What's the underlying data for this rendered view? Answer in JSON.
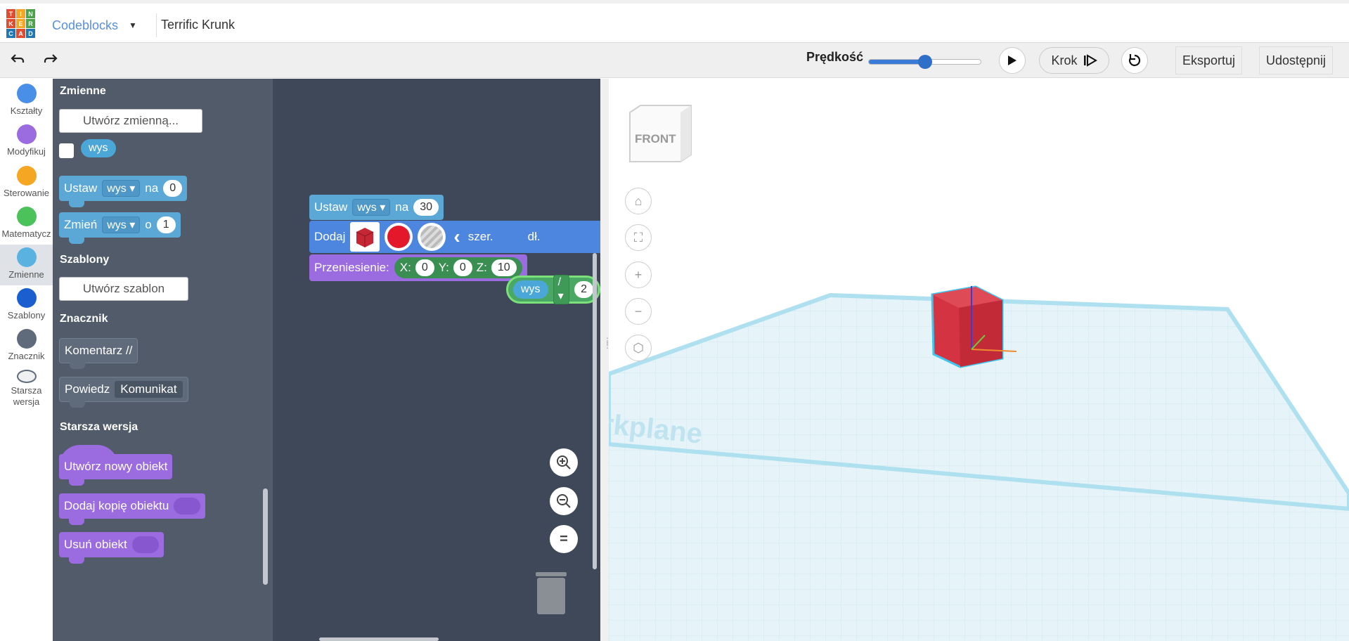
{
  "logo": {
    "letters": [
      "T",
      "I",
      "N",
      "K",
      "E",
      "R",
      "C",
      "A",
      "D"
    ],
    "colors": [
      "#e34b2f",
      "#f5a623",
      "#4da34b",
      "#e34b2f",
      "#f5a623",
      "#4da34b",
      "#1f77b4",
      "#e34b2f",
      "#1f77b4"
    ]
  },
  "header": {
    "mode": "Codeblocks",
    "project_title": "Terrific Krunk"
  },
  "toolbar": {
    "speed_label": "Prędkość",
    "speed_value": 0.5,
    "step_label": "Krok",
    "export_label": "Eksportuj",
    "share_label": "Udostępnij"
  },
  "categories": [
    {
      "label": "Kształty",
      "color": "#4a8fe7"
    },
    {
      "label": "Modyfikuj",
      "color": "#9b6be0"
    },
    {
      "label": "Sterowanie",
      "color": "#f5a623"
    },
    {
      "label": "Matematycz",
      "color": "#4cc25a"
    },
    {
      "label": "Zmienne",
      "color": "#5ab2e0"
    },
    {
      "label": "Szablony",
      "color": "#1a5fcf"
    },
    {
      "label": "Znacznik",
      "color": "#5f6b7b"
    },
    {
      "label": "Starsza wersja",
      "color": "#eef0f2"
    }
  ],
  "flyout": {
    "variables_heading": "Zmienne",
    "create_variable": "Utwórz zmienną...",
    "var_name": "wys",
    "set_block": {
      "keyword": "Ustaw",
      "var": "wys",
      "to": "na",
      "value": "0"
    },
    "change_block": {
      "keyword": "Zmień",
      "var": "wys",
      "by": "o",
      "value": "1"
    },
    "templates_heading": "Szablony",
    "create_template": "Utwórz szablon",
    "marker_heading": "Znacznik",
    "comment_block": "Komentarz //",
    "say_block": {
      "keyword": "Powiedz",
      "value": "Komunikat"
    },
    "legacy_heading": "Starsza wersja",
    "new_object_block": "Utwórz nowy obiekt",
    "copy_object_block": "Dodaj kopię obiektu",
    "delete_object_block": "Usuń obiekt"
  },
  "workspace": {
    "set_block": {
      "keyword": "Ustaw",
      "var": "wys",
      "to": "na",
      "value": "30"
    },
    "add_block": {
      "keyword": "Dodaj",
      "width_label": "szer.",
      "length_label": "dł."
    },
    "move_block": {
      "keyword": "Przeniesienie:",
      "x_label": "X:",
      "x": "0",
      "y_label": "Y:",
      "y": "0",
      "z_label": "Z:",
      "z": "10"
    },
    "math_block": {
      "var": "wys",
      "op": "/",
      "value": "2"
    }
  },
  "viewport": {
    "view_cube_label": "FRONT",
    "workplane_text": "rkplane"
  }
}
